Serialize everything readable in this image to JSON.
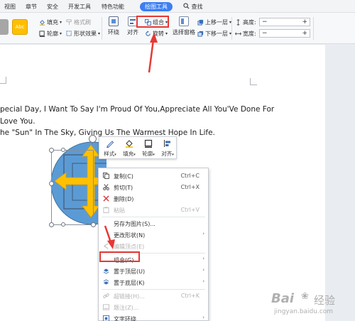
{
  "tabs": [
    {
      "label": "视图"
    },
    {
      "label": "章节"
    },
    {
      "label": "安全"
    },
    {
      "label": "开发工具"
    },
    {
      "label": "特色功能"
    },
    {
      "label": "绘图工具"
    }
  ],
  "search_label": "查找",
  "ribbon": {
    "style_swatch_label": "Abc",
    "fill": "填充",
    "format_brush": "格式刷",
    "outline": "轮廓",
    "shape_effects": "形状效果",
    "wrap_text": "环绕",
    "align": "对齐",
    "group": "组合",
    "rotate": "旋转",
    "selection_pane": "选择窗格",
    "bring_forward": "上移一层",
    "send_backward": "下移一层",
    "height_label": "高度:",
    "width_label": "宽度:",
    "height_value": "",
    "width_value": "",
    "minus": "−",
    "plus": "+"
  },
  "document": {
    "line1": "pecial Day, I Want To Say I'm Proud Of You,Appreciate All You'Ve Done For",
    "line2": "Love You.",
    "line3": "he \"Sun\" In The Sky, Giving Us The Warmest Hope In Life."
  },
  "float_toolbar": {
    "style": "样式",
    "fill": "填充",
    "outline": "轮廓",
    "align": "对齐"
  },
  "context_menu": {
    "items": [
      {
        "label": "复制(C)",
        "shortcut": "Ctrl+C"
      },
      {
        "label": "剪切(T)",
        "shortcut": "Ctrl+X"
      },
      {
        "label": "删除(D)",
        "shortcut": ""
      },
      {
        "label": "粘贴",
        "shortcut": "Ctrl+V"
      },
      {
        "label": "另存为图片(S)...",
        "shortcut": ""
      },
      {
        "label": "更改形状(N)",
        "shortcut": ""
      },
      {
        "label": "编辑顶点(E)",
        "shortcut": ""
      },
      {
        "label": "组合(G)",
        "shortcut": ""
      },
      {
        "label": "置于顶层(U)",
        "shortcut": ""
      },
      {
        "label": "置于底层(K)",
        "shortcut": ""
      },
      {
        "label": "超链接(H)...",
        "shortcut": "Ctrl+K"
      },
      {
        "label": "题注(Z)...",
        "shortcut": ""
      },
      {
        "label": "文字环绕",
        "shortcut": ""
      }
    ],
    "submenu_arrow": "›"
  },
  "watermark": {
    "line1": "Bai",
    "line2": "经验",
    "line3": "jingyan.baidu.com"
  },
  "colors": {
    "accent_blue": "#3c7ff2",
    "highlight_red": "#e53935",
    "circle_blue": "#5b9bd5",
    "arrow_gold": "#ffc000",
    "swatch_orange": "#ffbf00"
  }
}
